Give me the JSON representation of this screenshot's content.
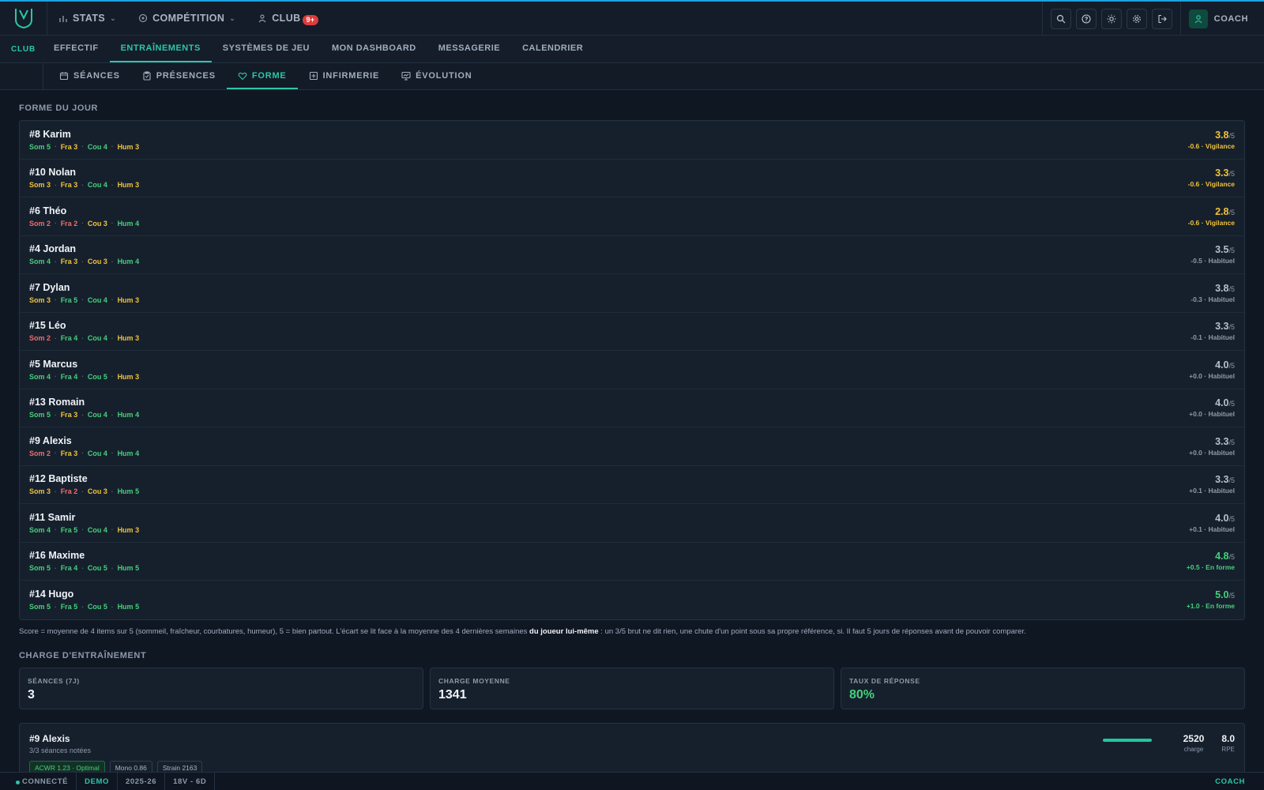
{
  "topbar": {
    "nav": [
      {
        "label": "STATS",
        "icon": "bar-chart-icon"
      },
      {
        "label": "COMPÉTITION",
        "icon": "target-icon"
      },
      {
        "label": "CLUB",
        "icon": "club-icon",
        "badge": "9+"
      }
    ],
    "user_label": "COACH"
  },
  "club_label": "CLUB",
  "club_tabs": [
    "EFFECTIF",
    "ENTRAÎNEMENTS",
    "SYSTÈMES DE JEU",
    "MON DASHBOARD",
    "MESSAGERIE",
    "CALENDRIER"
  ],
  "club_tab_active": "ENTRAÎNEMENTS",
  "sub_tabs": [
    {
      "label": "SÉANCES",
      "icon": "calendar-icon"
    },
    {
      "label": "PRÉSENCES",
      "icon": "clipboard-icon"
    },
    {
      "label": "FORME",
      "icon": "heart-icon"
    },
    {
      "label": "INFIRMERIE",
      "icon": "medical-icon"
    },
    {
      "label": "ÉVOLUTION",
      "icon": "chart-monitor-icon"
    }
  ],
  "sub_tab_active": "FORME",
  "forme": {
    "title": "FORME DU JOUR",
    "players": [
      {
        "name": "#8 Karim",
        "metrics": [
          [
            "Som 5",
            "green"
          ],
          [
            "Fra 3",
            "yellow"
          ],
          [
            "Cou 4",
            "green"
          ],
          [
            "Hum 3",
            "yellow"
          ]
        ],
        "score": "3.8",
        "delta": "-0.6 · Vigilance",
        "tone": "yellow"
      },
      {
        "name": "#10 Nolan",
        "metrics": [
          [
            "Som 3",
            "yellow"
          ],
          [
            "Fra 3",
            "yellow"
          ],
          [
            "Cou 4",
            "green"
          ],
          [
            "Hum 3",
            "yellow"
          ]
        ],
        "score": "3.3",
        "delta": "-0.6 · Vigilance",
        "tone": "yellow"
      },
      {
        "name": "#6 Théo",
        "metrics": [
          [
            "Som 2",
            "red"
          ],
          [
            "Fra 2",
            "red"
          ],
          [
            "Cou 3",
            "yellow"
          ],
          [
            "Hum 4",
            "green"
          ]
        ],
        "score": "2.8",
        "delta": "-0.6 · Vigilance",
        "tone": "yellow"
      },
      {
        "name": "#4 Jordan",
        "metrics": [
          [
            "Som 4",
            "green"
          ],
          [
            "Fra 3",
            "yellow"
          ],
          [
            "Cou 3",
            "yellow"
          ],
          [
            "Hum 4",
            "green"
          ]
        ],
        "score": "3.5",
        "delta": "-0.5 · Habituel",
        "tone": "gray"
      },
      {
        "name": "#7 Dylan",
        "metrics": [
          [
            "Som 3",
            "yellow"
          ],
          [
            "Fra 5",
            "green"
          ],
          [
            "Cou 4",
            "green"
          ],
          [
            "Hum 3",
            "yellow"
          ]
        ],
        "score": "3.8",
        "delta": "-0.3 · Habituel",
        "tone": "gray"
      },
      {
        "name": "#15 Léo",
        "metrics": [
          [
            "Som 2",
            "red"
          ],
          [
            "Fra 4",
            "green"
          ],
          [
            "Cou 4",
            "green"
          ],
          [
            "Hum 3",
            "yellow"
          ]
        ],
        "score": "3.3",
        "delta": "-0.1 · Habituel",
        "tone": "gray"
      },
      {
        "name": "#5 Marcus",
        "metrics": [
          [
            "Som 4",
            "green"
          ],
          [
            "Fra 4",
            "green"
          ],
          [
            "Cou 5",
            "green"
          ],
          [
            "Hum 3",
            "yellow"
          ]
        ],
        "score": "4.0",
        "delta": "+0.0 · Habituel",
        "tone": "gray"
      },
      {
        "name": "#13 Romain",
        "metrics": [
          [
            "Som 5",
            "green"
          ],
          [
            "Fra 3",
            "yellow"
          ],
          [
            "Cou 4",
            "green"
          ],
          [
            "Hum 4",
            "green"
          ]
        ],
        "score": "4.0",
        "delta": "+0.0 · Habituel",
        "tone": "gray"
      },
      {
        "name": "#9 Alexis",
        "metrics": [
          [
            "Som 2",
            "red"
          ],
          [
            "Fra 3",
            "yellow"
          ],
          [
            "Cou 4",
            "green"
          ],
          [
            "Hum 4",
            "green"
          ]
        ],
        "score": "3.3",
        "delta": "+0.0 · Habituel",
        "tone": "gray"
      },
      {
        "name": "#12 Baptiste",
        "metrics": [
          [
            "Som 3",
            "yellow"
          ],
          [
            "Fra 2",
            "red"
          ],
          [
            "Cou 3",
            "yellow"
          ],
          [
            "Hum 5",
            "green"
          ]
        ],
        "score": "3.3",
        "delta": "+0.1 · Habituel",
        "tone": "gray"
      },
      {
        "name": "#11 Samir",
        "metrics": [
          [
            "Som 4",
            "green"
          ],
          [
            "Fra 5",
            "green"
          ],
          [
            "Cou 4",
            "green"
          ],
          [
            "Hum 3",
            "yellow"
          ]
        ],
        "score": "4.0",
        "delta": "+0.1 · Habituel",
        "tone": "gray"
      },
      {
        "name": "#16 Maxime",
        "metrics": [
          [
            "Som 5",
            "green"
          ],
          [
            "Fra 4",
            "green"
          ],
          [
            "Cou 5",
            "green"
          ],
          [
            "Hum 5",
            "green"
          ]
        ],
        "score": "4.8",
        "delta": "+0.5 · En forme",
        "tone": "green"
      },
      {
        "name": "#14 Hugo",
        "metrics": [
          [
            "Som 5",
            "green"
          ],
          [
            "Fra 5",
            "green"
          ],
          [
            "Cou 5",
            "green"
          ],
          [
            "Hum 5",
            "green"
          ]
        ],
        "score": "5.0",
        "delta": "+1.0 · En forme",
        "tone": "green"
      }
    ],
    "score_suffix": "/5",
    "note_before": "Score = moyenne de 4 items sur 5 (sommeil, fraîcheur, courbatures, humeur), 5 = bien partout. L'écart se lit face à la moyenne des 4 dernières semaines ",
    "note_bold": "du joueur lui-même",
    "note_after": " : un 3/5 brut ne dit rien, une chute d'un point sous sa propre référence, si. Il faut 5 jours de réponses avant de pouvoir comparer."
  },
  "charge": {
    "title": "CHARGE D'ENTRAÎNEMENT",
    "kpis": [
      {
        "label": "SÉANCES (7J)",
        "value": "3"
      },
      {
        "label": "CHARGE MOYENNE",
        "value": "1341"
      },
      {
        "label": "TAUX DE RÉPONSE",
        "value": "80%"
      }
    ],
    "player": {
      "name": "#9 Alexis",
      "sub": "3/3 séances notées",
      "chips": [
        "ACWR 1.23 · Optimal",
        "Mono 0.86",
        "Strain 2163"
      ],
      "charge_value": "2520",
      "charge_label": "charge",
      "rpe_value": "8.0",
      "rpe_label": "RPE"
    }
  },
  "statusbar": {
    "status": "CONNECTÉ",
    "mode": "DEMO",
    "season": "2025-26",
    "record": "18V - 6D",
    "role": "COACH"
  },
  "colors": {
    "accent": "#2cc6a8",
    "green": "#45d07a",
    "yellow": "#f0c23b",
    "red": "#f06b6b",
    "topline": "#1aa3e0"
  }
}
